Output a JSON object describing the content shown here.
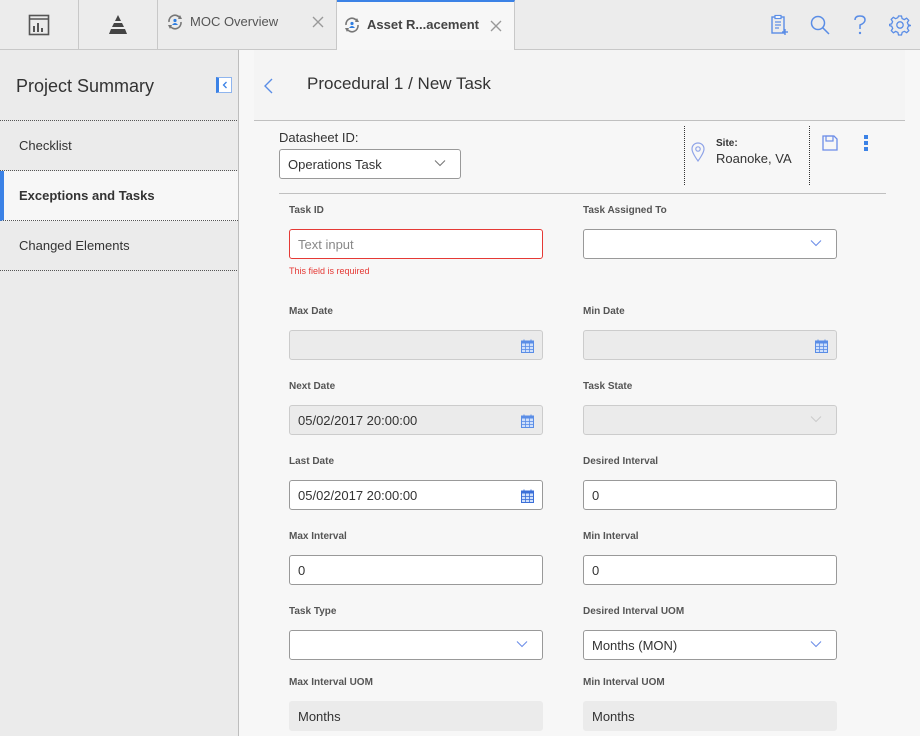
{
  "topbar": {
    "tabs": [
      {
        "icon": "dashboard-icon"
      },
      {
        "icon": "pyramid-icon"
      },
      {
        "label": "MOC Overview",
        "icon": "moc-sync-icon",
        "closable": true,
        "active": false
      },
      {
        "label": "Asset R...acement",
        "icon": "moc-sync-icon",
        "closable": true,
        "active": true
      }
    ],
    "actions": [
      "new-record-icon",
      "search-icon",
      "help-icon",
      "gear-icon"
    ]
  },
  "sidebar": {
    "title": "Project Summary",
    "items": [
      {
        "label": "Checklist",
        "active": false
      },
      {
        "label": "Exceptions and Tasks",
        "active": true
      },
      {
        "label": "Changed Elements",
        "active": false
      }
    ]
  },
  "main": {
    "title": "Procedural 1 / New Task",
    "datasheet": {
      "label": "Datasheet ID:",
      "value": "Operations Task"
    },
    "site": {
      "label": "Site:",
      "value": "Roanoke, VA"
    }
  },
  "form": {
    "task_id": {
      "label": "Task ID",
      "value": "",
      "placeholder": "Text input",
      "error": "This field is required"
    },
    "task_assigned_to": {
      "label": "Task Assigned To",
      "value": ""
    },
    "max_date": {
      "label": "Max Date",
      "value": ""
    },
    "min_date": {
      "label": "Min Date",
      "value": ""
    },
    "next_date": {
      "label": "Next Date",
      "value": "05/02/2017 20:00:00"
    },
    "task_state": {
      "label": "Task State",
      "value": ""
    },
    "last_date": {
      "label": "Last Date",
      "value": "05/02/2017 20:00:00"
    },
    "desired_interval": {
      "label": "Desired Interval",
      "value": "0"
    },
    "max_interval": {
      "label": "Max Interval",
      "value": "0"
    },
    "min_interval": {
      "label": "Min Interval",
      "value": "0"
    },
    "task_type": {
      "label": "Task Type",
      "value": ""
    },
    "desired_interval_uom": {
      "label": "Desired Interval UOM",
      "value": "Months (MON)"
    },
    "max_interval_uom": {
      "label": "Max Interval UOM",
      "value": "Months"
    },
    "min_interval_uom": {
      "label": "Min Interval UOM",
      "value": "Months"
    }
  },
  "colors": {
    "accent": "#3b82e6",
    "error": "#e53935",
    "icon_blue": "#5a8de6"
  }
}
